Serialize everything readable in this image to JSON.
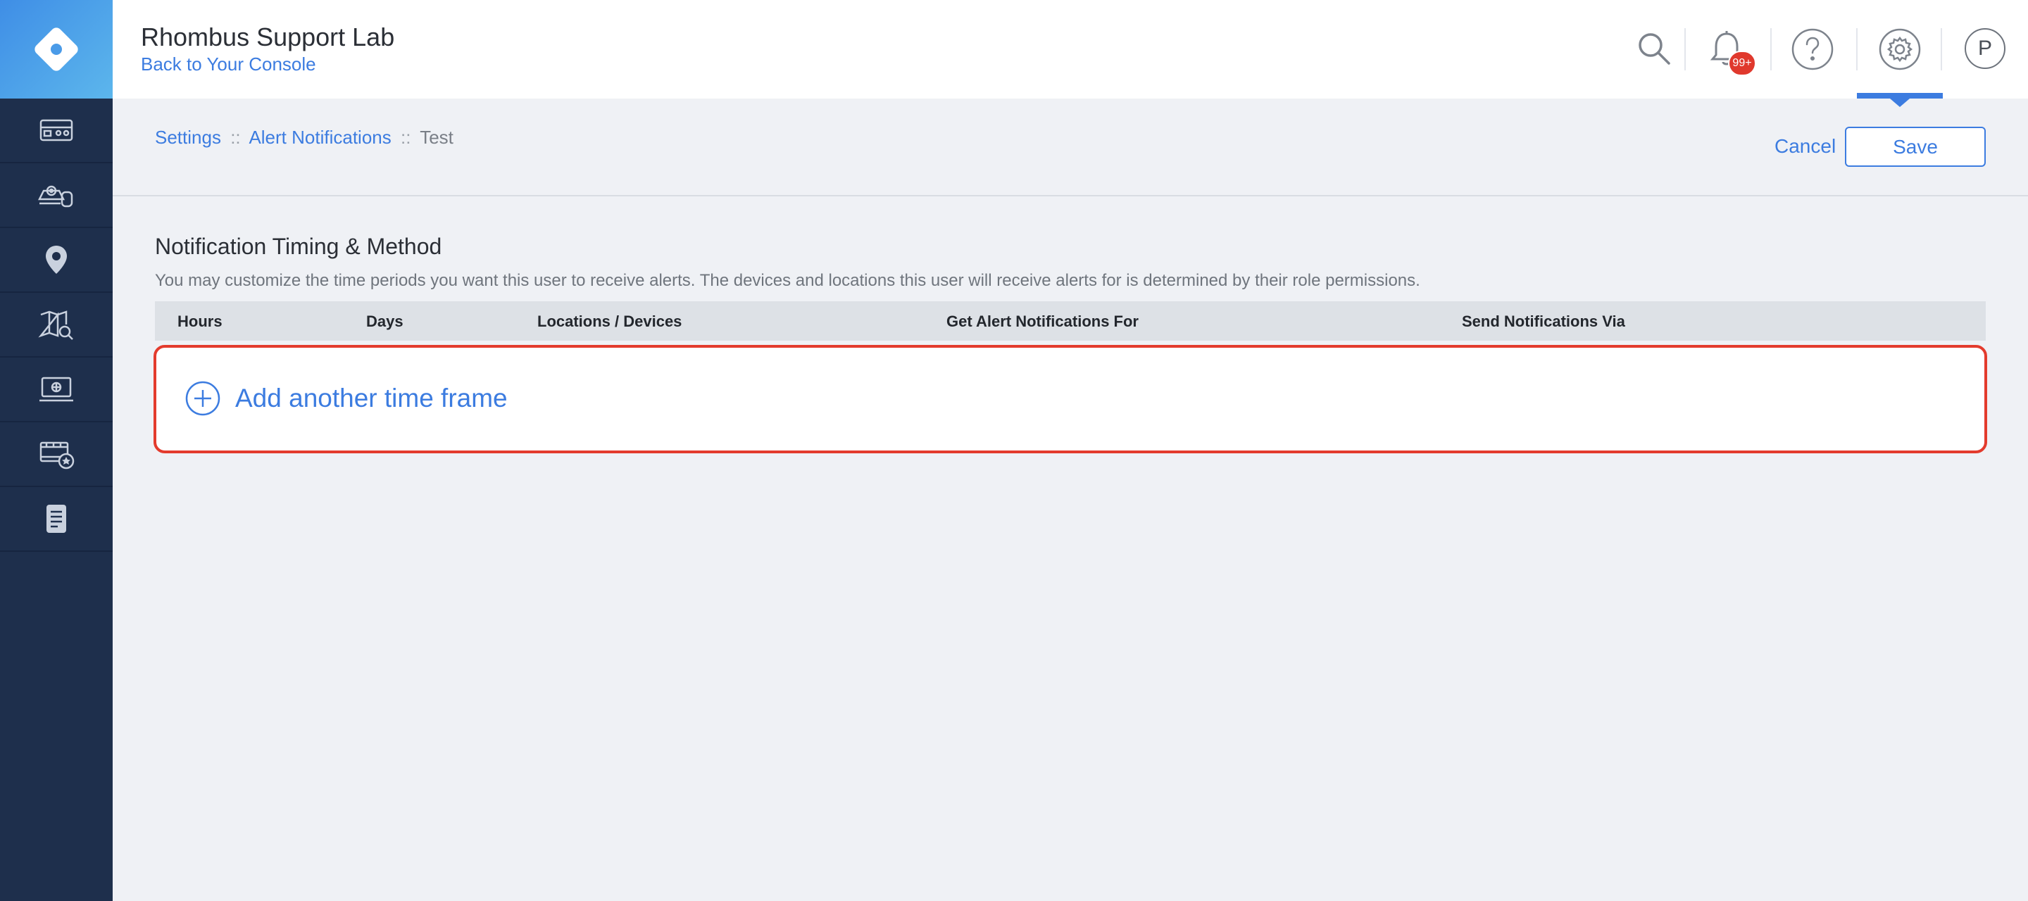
{
  "header": {
    "org_name": "Rhombus Support Lab",
    "back_link": "Back to Your Console",
    "notification_badge": "99+",
    "avatar_initial": "P"
  },
  "sidebar": {
    "items": [
      {
        "name": "dashboard-icon"
      },
      {
        "name": "devices-icon"
      },
      {
        "name": "locations-icon"
      },
      {
        "name": "map-search-icon"
      },
      {
        "name": "video-wall-icon"
      },
      {
        "name": "saved-clips-icon"
      },
      {
        "name": "reports-icon"
      }
    ]
  },
  "breadcrumb": {
    "settings": "Settings",
    "sep": "::",
    "alert_notifications": "Alert Notifications",
    "current": "Test"
  },
  "actions": {
    "cancel": "Cancel",
    "save": "Save"
  },
  "section": {
    "title": "Notification Timing & Method",
    "description": "You may customize the time periods you want this user to receive alerts. The devices and locations this user will receive alerts for is determined by their role permissions."
  },
  "table": {
    "columns": [
      "Hours",
      "Days",
      "Locations / Devices",
      "Get Alert Notifications For",
      "Send Notifications Via"
    ]
  },
  "add_time_frame": "Add another time frame",
  "colors": {
    "accent": "#3c7ce0",
    "sidebar": "#1e2f4c",
    "highlight": "#e33b2d",
    "badge": "#e0392d"
  }
}
